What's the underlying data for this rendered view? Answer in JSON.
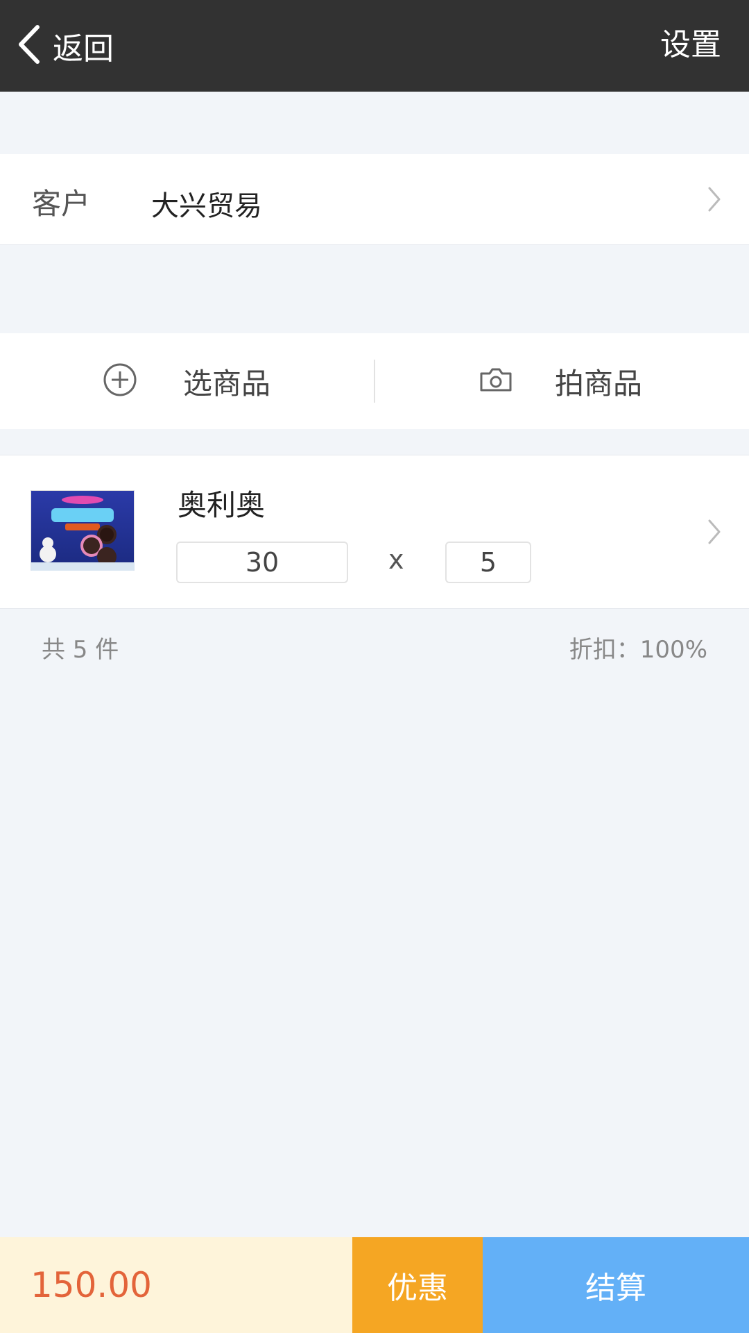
{
  "header": {
    "back_label": "返回",
    "settings_label": "设置"
  },
  "customer": {
    "label": "客户",
    "value": "大兴贸易"
  },
  "actions": {
    "select_label": "选商品",
    "photo_label": "拍商品"
  },
  "item": {
    "name": "奥利奥",
    "price": "30",
    "times": "x",
    "quantity": "5",
    "thumbnail_text": "奥利奥"
  },
  "summary": {
    "total_label": "共 5 件",
    "discount_label": "折扣：100%"
  },
  "footer": {
    "amount": "150.00",
    "discount_button": "优惠",
    "checkout_button": "结算"
  },
  "colors": {
    "topbar": "#323232",
    "background": "#f2f5f9",
    "amount": "#e3643a",
    "discount_btn": "#f5a623",
    "checkout_btn": "#63b0f7",
    "footer_bg": "#fef4da"
  }
}
